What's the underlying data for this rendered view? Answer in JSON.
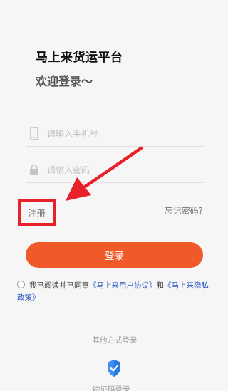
{
  "header": {
    "app_title": "马上来货运平台",
    "welcome": "欢迎登录～"
  },
  "form": {
    "phone_placeholder": "请输入手机号",
    "password_placeholder": "请输入密码",
    "register_label": "注册",
    "forgot_label": "忘记密码?",
    "login_label": "登录"
  },
  "agreement": {
    "prefix": "我已阅读并已同意",
    "user_agreement": "《马上来用户协议》",
    "and": "和",
    "privacy_policy": "《马上来隐私政策》"
  },
  "other_login": {
    "title": "其他方式登录",
    "sms_label": "验证码登录"
  },
  "colors": {
    "accent": "#f05a28",
    "highlight_box": "#e8202a",
    "link": "#2c58c8"
  },
  "icons": [
    "phone-icon",
    "lock-icon",
    "shield-check-icon",
    "red-annotation-arrow"
  ]
}
